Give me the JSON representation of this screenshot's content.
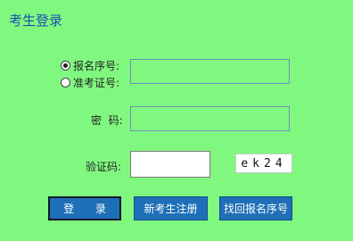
{
  "page": {
    "title": "考生登录"
  },
  "login_type": {
    "options": [
      {
        "label": "报名序号:",
        "selected": true
      },
      {
        "label": "准考证号:",
        "selected": false
      }
    ]
  },
  "form": {
    "id_value": "",
    "password_label": "密  码:",
    "password_value": "",
    "captcha_label": "验证码:",
    "captcha_value": "",
    "captcha_image_text": "ek24"
  },
  "buttons": {
    "login": "登 录",
    "register": "新考生注册",
    "recover": "找回报名序号"
  },
  "colors": {
    "background": "#80f880",
    "button": "#1e6fb7",
    "title": "#1b4fb0"
  }
}
